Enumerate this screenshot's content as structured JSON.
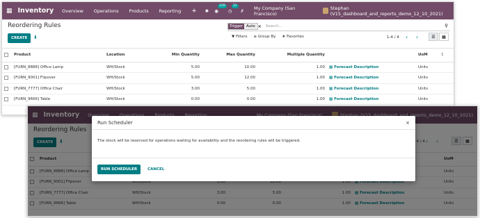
{
  "navbar": {
    "app_name": "Inventory",
    "menus": [
      "Overview",
      "Operations",
      "Products",
      "Reporting"
    ],
    "plus": "+",
    "bug_icon": "bug-icon",
    "chat_badge": "229",
    "activity_badge": "31",
    "company": "My Company (San Francisco)",
    "user": "Stephan (V15_dashboard_and_reports_demo_12_10_2021)",
    "user2": "Stephan (V15_dashboard_and_reports_demo_12_10_2021)"
  },
  "page": {
    "title": "Reordering Rules",
    "create_label": "CREATE",
    "search_facet_key": "Trigger",
    "search_facet_value": "Auto",
    "search_placeholder": "Search...",
    "filters_label": "Filters",
    "groupby_label": "Group By",
    "favorites_label": "Favorites",
    "pager": "1-4 / 4",
    "pager2": "1-4 / 4"
  },
  "table": {
    "headers": {
      "product": "Product",
      "location": "Location",
      "min_qty": "Min Quantity",
      "max_qty": "Max Quantity",
      "multiple_qty": "Multiple Quantity",
      "uom": "UoM"
    },
    "rows": [
      {
        "product": "[FURN_8888] Office Lamp",
        "location": "WH/Stock",
        "min": "5.00",
        "max": "10.00",
        "multiple": "1.00",
        "forecast": "Forecast Description",
        "uom": "Units"
      },
      {
        "product": "[FURN_9001] Flipover",
        "location": "WH/Stock",
        "min": "5.00",
        "max": "12.00",
        "multiple": "1.00",
        "forecast": "Forecast Description",
        "uom": "Units"
      },
      {
        "product": "[FURN_7777] Office Chair",
        "location": "WH/Stock",
        "min": "3.00",
        "max": "5.00",
        "multiple": "1.00",
        "forecast": "Forecast Description",
        "uom": "Units"
      },
      {
        "product": "[FURN_9666] Table",
        "location": "WH/Stock",
        "min": "0.00",
        "max": "0.00",
        "multiple": "1.00",
        "forecast": "Forecast Description",
        "uom": "Units"
      }
    ]
  },
  "modal": {
    "title": "Run Scheduler",
    "body": "The stock will be reserved for operations waiting for availability and the reordering rules will be triggered.",
    "run_label": "RUN SCHEDULER",
    "cancel_label": "CANCEL",
    "close": "×"
  },
  "colors": {
    "brand": "#714b67",
    "accent": "#017e84"
  }
}
